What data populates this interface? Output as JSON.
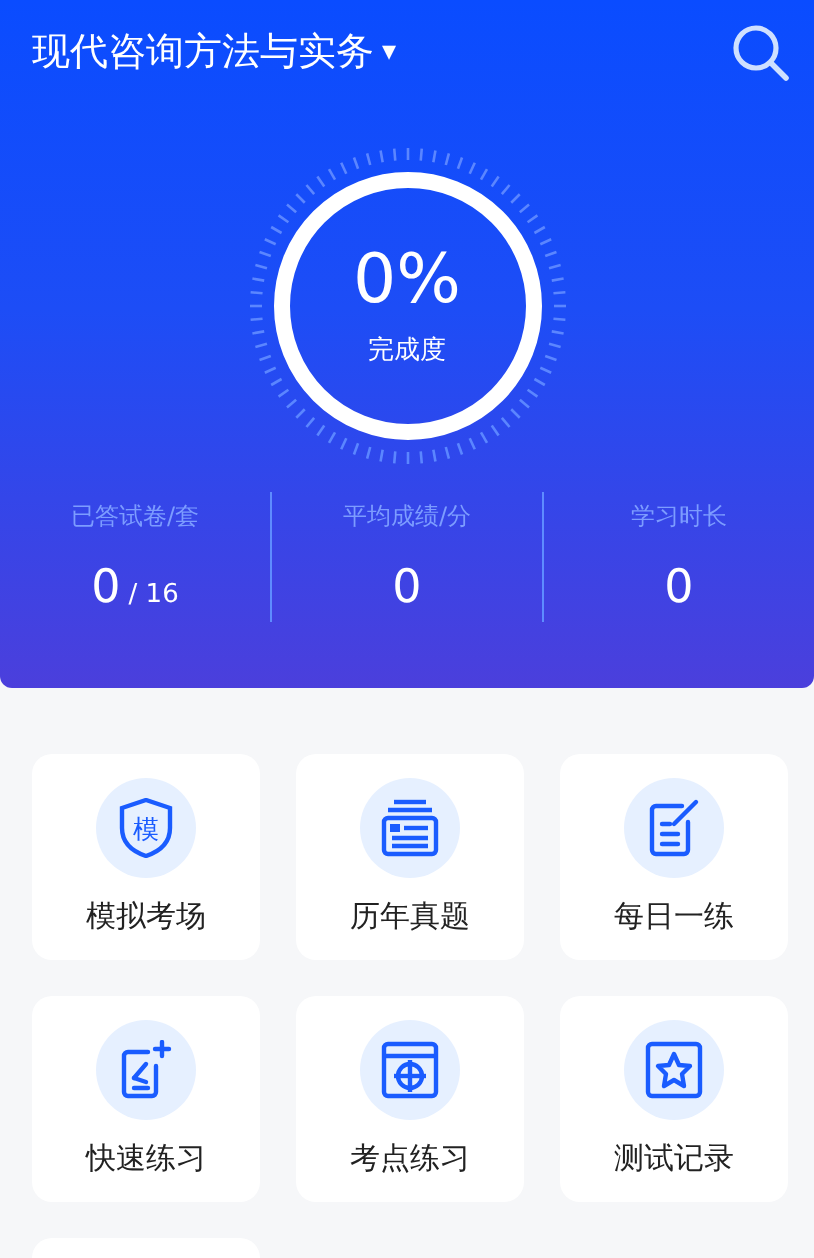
{
  "header": {
    "title": "现代咨询方法与实务",
    "dropdown": "▾"
  },
  "progress": {
    "percent": "0%",
    "label": "完成度",
    "level": 0
  },
  "stats": [
    {
      "label": "已答试卷/套",
      "value": "0",
      "total": "/ 16"
    },
    {
      "label": "平均成绩/分",
      "value": "0"
    },
    {
      "label": "学习时长",
      "value": "0"
    }
  ],
  "tiles": [
    {
      "kind": "mock",
      "label": "模拟考场",
      "icon_text": "模"
    },
    {
      "kind": "papers",
      "label": "历年真题"
    },
    {
      "kind": "daily",
      "label": "每日一练"
    },
    {
      "kind": "quick",
      "label": "快速练习"
    },
    {
      "kind": "points",
      "label": "考点练习"
    },
    {
      "kind": "record",
      "label": "测试记录"
    }
  ]
}
